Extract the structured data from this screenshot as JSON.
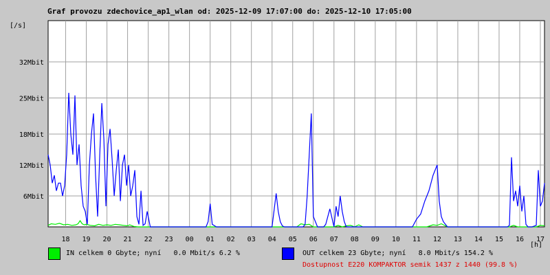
{
  "title": "Graf provozu zdechovice_ap1_wlan od: 2025-12-09 17:07:00 do: 2025-12-10 17:05:00",
  "colors": {
    "in": "#00ee00",
    "out": "#0000ff",
    "grid": "#a0a0a0",
    "plot_bg": "#ffffff",
    "availability": "#e00000"
  },
  "legend": {
    "in": "IN celkem 0 Gbyte; nyní   0.0 Mbit/s 6.2 %",
    "out": "OUT celkem 23 Gbyte; nyní   8.0 Mbit/s 154.2 %",
    "availability": "Dostupnost E220 KOMPAKTOR semik 1437 z 1440 (99.8 %)"
  },
  "chart_data": {
    "type": "line",
    "title": "Graf provozu zdechovice_ap1_wlan od: 2025-12-09 17:07:00 do: 2025-12-10 17:05:00",
    "xlabel": "[h]",
    "ylabel": "[/s]",
    "unit": "Mbit",
    "ylim": [
      0,
      40
    ],
    "xlim": [
      17.15,
      41.2
    ],
    "yticks": [
      6,
      12,
      18,
      25,
      32
    ],
    "ytick_labels": [
      "6Mbit",
      "12Mbit",
      "18Mbit",
      "25Mbit",
      "32Mbit"
    ],
    "xticks": [
      18,
      19,
      20,
      21,
      22,
      23,
      24,
      25,
      26,
      27,
      28,
      29,
      30,
      31,
      32,
      33,
      34,
      35,
      36,
      37,
      38,
      39,
      40,
      41
    ],
    "xtick_labels": [
      "18",
      "19",
      "20",
      "21",
      "22",
      "23",
      "00",
      "01",
      "02",
      "03",
      "04",
      "05",
      "06",
      "07",
      "08",
      "09",
      "10",
      "11",
      "12",
      "13",
      "14",
      "15",
      "16",
      "17"
    ],
    "grid": true,
    "series": [
      {
        "name": "IN",
        "color": "#00ee00",
        "x": [
          17.15,
          17.3,
          17.5,
          17.7,
          17.9,
          18.1,
          18.3,
          18.5,
          18.6,
          18.7,
          18.8,
          18.9,
          19.0,
          19.2,
          19.4,
          19.6,
          19.8,
          20.0,
          20.2,
          20.4,
          20.6,
          20.8,
          21.0,
          21.1,
          21.3,
          21.5,
          21.8,
          22.0,
          24.0,
          26.0,
          28.0,
          29.2,
          29.4,
          29.6,
          29.8,
          30.0,
          30.2,
          30.6,
          31.0,
          31.2,
          31.4,
          31.6,
          31.8,
          32.0,
          32.2,
          32.4,
          34.0,
          35.5,
          35.8,
          36.0,
          36.2,
          36.5,
          38.0,
          39.5,
          39.7,
          39.9,
          40.1,
          40.5,
          40.8,
          41.0,
          41.2
        ],
        "y": [
          0.3,
          0.6,
          0.5,
          0.7,
          0.4,
          0.5,
          0.3,
          0.4,
          0.6,
          1.2,
          0.6,
          0.4,
          0.5,
          0.3,
          0.2,
          0.5,
          0.3,
          0.4,
          0.3,
          0.5,
          0.4,
          0.3,
          0.2,
          0.4,
          0.1,
          0.0,
          0.0,
          0.0,
          0.0,
          0.0,
          0.0,
          0.0,
          0.6,
          0.4,
          0.5,
          0.0,
          0.0,
          0.0,
          0.0,
          0.3,
          0.0,
          0.2,
          0.3,
          0.0,
          0.4,
          0.0,
          0.0,
          0.0,
          0.4,
          0.3,
          0.6,
          0.0,
          0.0,
          0.0,
          0.3,
          0.0,
          0.0,
          0.0,
          0.0,
          0.3,
          0.2
        ]
      },
      {
        "name": "OUT",
        "color": "#0000ff",
        "x": [
          17.15,
          17.25,
          17.35,
          17.45,
          17.55,
          17.65,
          17.75,
          17.85,
          17.95,
          18.05,
          18.15,
          18.25,
          18.35,
          18.45,
          18.55,
          18.65,
          18.75,
          18.85,
          18.95,
          19.05,
          19.15,
          19.25,
          19.35,
          19.45,
          19.55,
          19.65,
          19.75,
          19.85,
          19.95,
          20.05,
          20.15,
          20.25,
          20.35,
          20.45,
          20.55,
          20.65,
          20.75,
          20.85,
          20.95,
          21.05,
          21.15,
          21.25,
          21.35,
          21.45,
          21.55,
          21.65,
          21.75,
          21.85,
          21.95,
          22.1,
          22.5,
          23.0,
          24.0,
          24.8,
          24.9,
          25.0,
          25.1,
          25.3,
          26.0,
          27.0,
          27.5,
          28.0,
          28.2,
          28.3,
          28.4,
          28.5,
          28.6,
          28.8,
          29.0,
          29.5,
          29.6,
          29.7,
          29.8,
          29.9,
          30.0,
          30.2,
          30.5,
          30.6,
          30.8,
          31.0,
          31.1,
          31.2,
          31.3,
          31.4,
          31.5,
          31.6,
          31.7,
          31.8,
          31.9,
          32.0,
          32.2,
          33.0,
          34.0,
          34.8,
          35.0,
          35.2,
          35.4,
          35.6,
          35.8,
          36.0,
          36.1,
          36.2,
          36.3,
          36.4,
          36.5,
          36.7,
          37.0,
          38.0,
          38.4,
          38.6,
          39.0,
          39.4,
          39.5,
          39.6,
          39.7,
          39.8,
          39.9,
          40.0,
          40.1,
          40.2,
          40.3,
          40.4,
          40.6,
          40.8,
          40.9,
          41.0,
          41.1,
          41.2
        ],
        "y": [
          14.0,
          12.0,
          8.5,
          10.0,
          7.0,
          8.5,
          8.5,
          6.0,
          8.0,
          14.0,
          26.0,
          18.0,
          14.0,
          25.5,
          12.0,
          16.0,
          8.0,
          4.0,
          3.0,
          0.5,
          12.0,
          18.0,
          22.0,
          10.0,
          2.0,
          14.0,
          24.0,
          17.0,
          4.0,
          16.0,
          19.0,
          13.0,
          6.0,
          11.0,
          15.0,
          5.0,
          12.0,
          14.0,
          8.0,
          12.0,
          6.0,
          8.0,
          11.0,
          2.0,
          0.5,
          7.0,
          0.3,
          0.6,
          3.0,
          0.0,
          0.0,
          0.0,
          0.0,
          0.0,
          1.0,
          4.5,
          0.5,
          0.0,
          0.0,
          0.0,
          0.0,
          0.0,
          6.5,
          3.0,
          1.0,
          0.2,
          0.0,
          0.0,
          0.0,
          0.0,
          0.5,
          6.0,
          14.0,
          22.0,
          2.0,
          0.0,
          0.0,
          0.5,
          3.5,
          0.0,
          4.0,
          2.0,
          6.0,
          3.0,
          1.0,
          0.0,
          0.0,
          0.0,
          0.0,
          0.0,
          0.0,
          0.0,
          0.0,
          0.0,
          1.5,
          2.5,
          5.0,
          7.0,
          10.0,
          12.0,
          5.0,
          2.0,
          1.0,
          0.5,
          0.0,
          0.0,
          0.0,
          0.0,
          0.0,
          0.0,
          0.0,
          0.0,
          0.3,
          13.5,
          5.0,
          7.0,
          4.0,
          8.0,
          3.0,
          6.0,
          0.5,
          0.0,
          0.0,
          0.3,
          11.0,
          4.0,
          5.0,
          8.5
        ]
      }
    ]
  }
}
